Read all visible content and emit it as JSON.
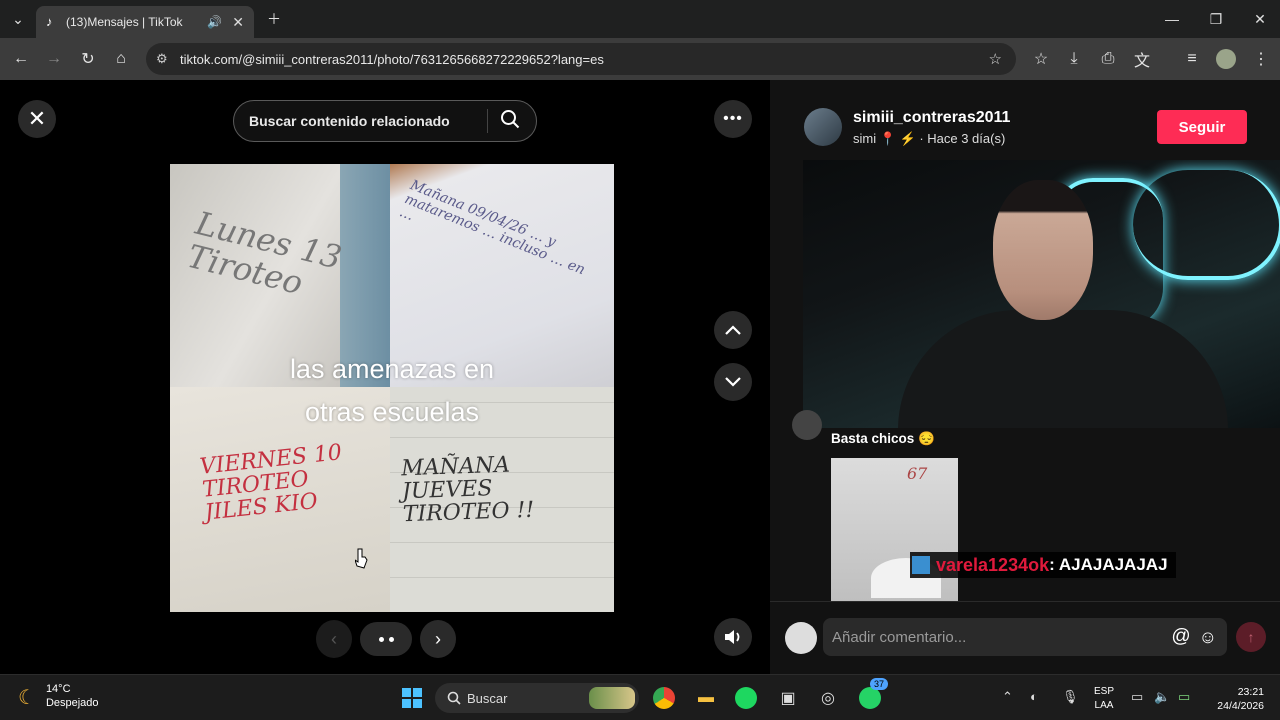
{
  "browser": {
    "tab_title": "(13)Mensajes | TikTok",
    "url": "tiktok.com/@simiii_contreras2011/photo/7631265668272229652?lang=es"
  },
  "viewer": {
    "search_placeholder": "Buscar contenido relacionado",
    "caption_line1": "las amenazas en",
    "caption_line2": "otras escuelas",
    "photo_text": {
      "tl": "Lunes 13 Tiroteo",
      "tr": "Mañana 09/04/26 … y mataremos … incluso … en …",
      "bl": "VIERNES 10 TIROTEO JILES KIO",
      "br": "MAÑANA JUEVES TIROTEO !!"
    }
  },
  "post": {
    "author_name": "simiii_contreras2011",
    "author_sub": "simi 📍 ⚡ · Hace 3 día(s)",
    "follow_label": "Seguir",
    "comment_text": "Basta chicos 😔",
    "comment_image_text": "67",
    "comment_placeholder": "Añadir comentario..."
  },
  "stream_overlay": {
    "user": "varela1234ok",
    "message": " : AJAJAJAJAJ"
  },
  "taskbar": {
    "temp": "14°C",
    "condition": "Despejado",
    "search_placeholder": "Buscar",
    "whatsapp_badge": "37",
    "lang_top": "ESP",
    "lang_bottom": "LAA",
    "time": "23:21",
    "date": "24/4/2026"
  },
  "colors": {
    "tiktok_red": "#fe2c55",
    "overlay_user": "#e01a3c"
  }
}
